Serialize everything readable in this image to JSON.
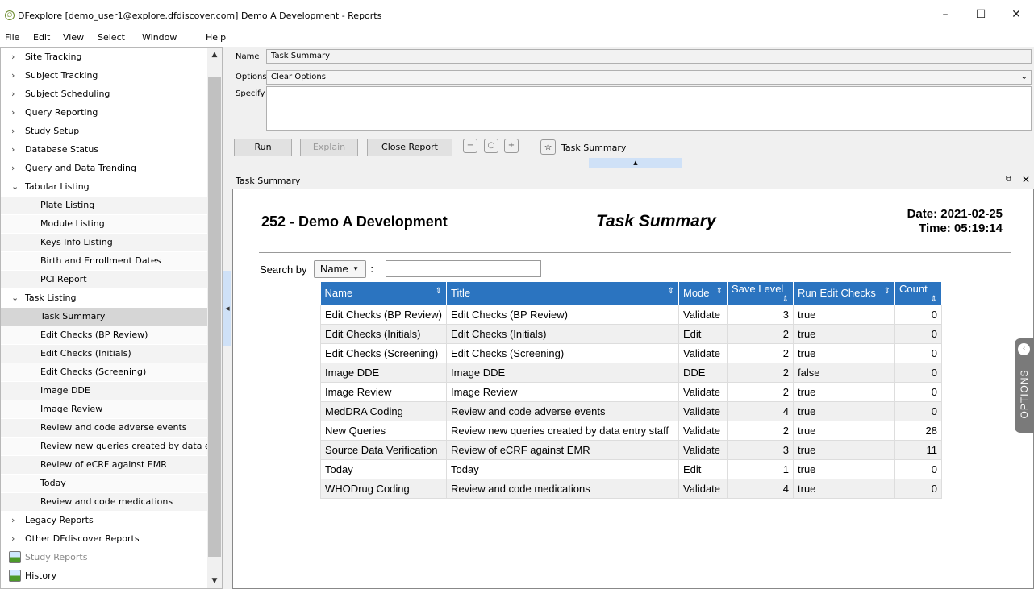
{
  "window": {
    "title": "DFexplore [demo_user1@explore.dfdiscover.com] Demo A Development - Reports",
    "minimize": "–",
    "maximize": "☐",
    "close": "✕"
  },
  "menu": [
    "File",
    "Edit",
    "View",
    "Select",
    "Window",
    "Help"
  ],
  "sidebar": {
    "top_before": [
      "Site Tracking",
      "Subject Tracking",
      "Subject Scheduling",
      "Query Reporting",
      "Study Setup",
      "Database Status",
      "Query and Data Trending"
    ],
    "tabular": {
      "label": "Tabular Listing",
      "items": [
        "Plate Listing",
        "Module Listing",
        "Keys Info Listing",
        "Birth and Enrollment Dates",
        "PCI Report"
      ]
    },
    "task": {
      "label": "Task Listing",
      "items": [
        "Task Summary",
        "Edit Checks (BP Review)",
        "Edit Checks (Initials)",
        "Edit Checks (Screening)",
        "Image DDE",
        "Image Review",
        "Review and code adverse events",
        "Review new queries created by data e...",
        "Review of eCRF against EMR",
        "Today",
        "Review and code medications"
      ]
    },
    "top_after": [
      "Legacy Reports",
      "Other DFdiscover Reports"
    ],
    "icon_items": [
      "Study Reports",
      "History"
    ]
  },
  "form": {
    "name_label": "Name",
    "name_value": "Task Summary",
    "options_label": "Options",
    "options_value": "Clear Options",
    "specify_label": "Specify",
    "specify_value": ""
  },
  "toolbar": {
    "run": "Run",
    "explain": "Explain",
    "close_report": "Close Report",
    "favorite_label": "Task Summary"
  },
  "report_panel": {
    "title": "Task Summary"
  },
  "report": {
    "study": "252 - Demo A Development",
    "title": "Task Summary",
    "date": "Date: 2021-02-25",
    "time": "Time: 05:19:14",
    "search_label": "Search by",
    "search_field": "Name",
    "columns": [
      "Name",
      "Title",
      "Mode",
      "Save Level",
      "Run Edit Checks",
      "Count"
    ],
    "rows": [
      [
        "Edit Checks (BP Review)",
        "Edit Checks (BP Review)",
        "Validate",
        "3",
        "true",
        "0"
      ],
      [
        "Edit Checks (Initials)",
        "Edit Checks (Initials)",
        "Edit",
        "2",
        "true",
        "0"
      ],
      [
        "Edit Checks (Screening)",
        "Edit Checks (Screening)",
        "Validate",
        "2",
        "true",
        "0"
      ],
      [
        "Image DDE",
        "Image DDE",
        "DDE",
        "2",
        "false",
        "0"
      ],
      [
        "Image Review",
        "Image Review",
        "Validate",
        "2",
        "true",
        "0"
      ],
      [
        "MedDRA Coding",
        "Review and code adverse events",
        "Validate",
        "4",
        "true",
        "0"
      ],
      [
        "New Queries",
        "Review new queries created by data entry staff",
        "Validate",
        "2",
        "true",
        "28"
      ],
      [
        "Source Data Verification",
        "Review of eCRF against EMR",
        "Validate",
        "3",
        "true",
        "11"
      ],
      [
        "Today",
        "Today",
        "Edit",
        "1",
        "true",
        "0"
      ],
      [
        "WHODrug Coding",
        "Review and code medications",
        "Validate",
        "4",
        "true",
        "0"
      ]
    ]
  },
  "options_tab": "OPTIONS"
}
